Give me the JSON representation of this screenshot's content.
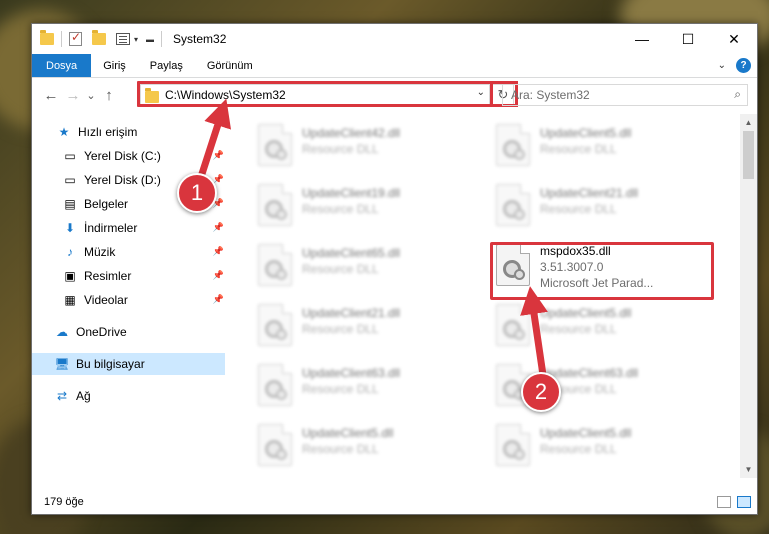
{
  "window": {
    "title": "System32",
    "minimize": "—",
    "maximize": "☐",
    "close": "✕"
  },
  "ribbon": {
    "tabs": [
      "Dosya",
      "Giriş",
      "Paylaş",
      "Görünüm"
    ],
    "help": "?"
  },
  "navbar": {
    "back": "←",
    "forward": "→",
    "recent": "⌄",
    "up": "↑",
    "address": "C:\\Windows\\System32",
    "refresh": "↻",
    "search_placeholder": "Ara: System32"
  },
  "sidebar": {
    "items": [
      {
        "label": "Hızlı erişim",
        "icon": "star-icon",
        "pinned": false
      },
      {
        "label": "Yerel Disk (C:)",
        "icon": "drive-icon",
        "pinned": true
      },
      {
        "label": "Yerel Disk (D:)",
        "icon": "drive-icon",
        "pinned": true
      },
      {
        "label": "Belgeler",
        "icon": "document-icon",
        "pinned": true
      },
      {
        "label": "İndirmeler",
        "icon": "download-icon",
        "pinned": true
      },
      {
        "label": "Müzik",
        "icon": "music-icon",
        "pinned": true
      },
      {
        "label": "Resimler",
        "icon": "pictures-icon",
        "pinned": true
      },
      {
        "label": "Videolar",
        "icon": "video-icon",
        "pinned": true
      },
      {
        "label": "OneDrive",
        "icon": "cloud-icon",
        "pinned": false
      },
      {
        "label": "Bu bilgisayar",
        "icon": "computer-icon",
        "pinned": false,
        "selected": true
      },
      {
        "label": "Ağ",
        "icon": "network-icon",
        "pinned": false
      }
    ]
  },
  "files": [
    {
      "name": "UpdateClient42.dll",
      "sub": "Resource DLL"
    },
    {
      "name": "UpdateClient5.dll",
      "sub": "Resource DLL"
    },
    {
      "name": "UpdateClient19.dll",
      "sub": "Resource DLL"
    },
    {
      "name": "UpdateClient21.dll",
      "sub": "Resource DLL"
    },
    {
      "name": "UpdateClient65.dll",
      "sub": "Resource DLL"
    },
    {
      "name": "mspdox35.dll",
      "sub": "3.51.3007.0",
      "sub2": "Microsoft Jet Parad...",
      "highlighted": true
    },
    {
      "name": "UpdateClient21.dll",
      "sub": "Resource DLL"
    },
    {
      "name": "UpdateClient5.dll",
      "sub": "Resource DLL"
    },
    {
      "name": "UpdateClient63.dll",
      "sub": "Resource DLL"
    },
    {
      "name": "UpdateClient63.dll",
      "sub": "Resource DLL"
    },
    {
      "name": "UpdateClient5.dll",
      "sub": "Resource DLL"
    },
    {
      "name": "UpdateClient5.dll",
      "sub": "Resource DLL"
    }
  ],
  "status": {
    "count": "179 öğe"
  },
  "annotations": {
    "step1": "1",
    "step2": "2",
    "color": "#d9353d"
  }
}
